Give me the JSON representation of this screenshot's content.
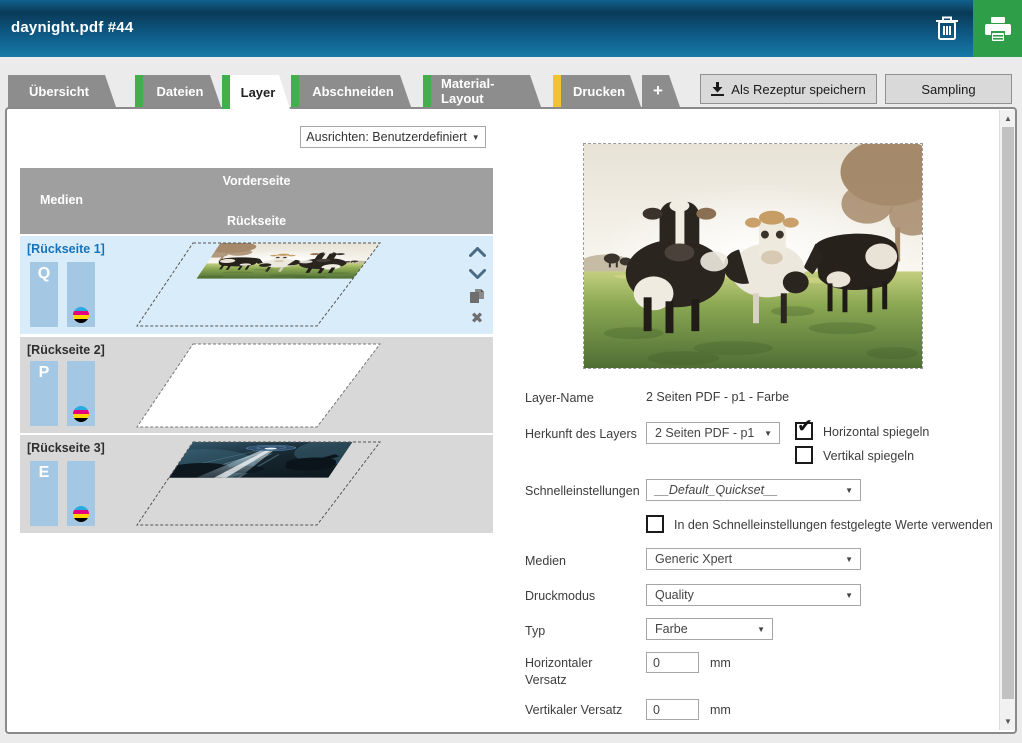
{
  "title_bar": {
    "title": "daynight.pdf #44",
    "trash_icon": "trash",
    "print_icon": "printer"
  },
  "tabs": [
    {
      "label": "Übersicht",
      "accent": null,
      "active": false
    },
    {
      "label": "Dateien",
      "accent": "#43af4c",
      "active": false
    },
    {
      "label": "Layer",
      "accent": "#43af4c",
      "active": true
    },
    {
      "label": "Abschneiden",
      "accent": "#43af4c",
      "active": false
    },
    {
      "label": "Material-Layout",
      "accent": "#43af4c",
      "active": false
    },
    {
      "label": "Drucken",
      "accent": "#f2c331",
      "active": false
    },
    {
      "label": "+",
      "accent": null,
      "active": false
    }
  ],
  "actions": {
    "save_recipe_label": "Als Rezeptur speichern",
    "sampling_label": "Sampling"
  },
  "align_dropdown": {
    "value": "Ausrichten: Benutzerdefiniert"
  },
  "media_table": {
    "col_medien": "Medien",
    "col_front": "Vorderseite",
    "col_back": "Rückseite",
    "rows": [
      {
        "label": "[Rückseite 1]",
        "badge": "Q",
        "selected": true,
        "thumb": "cows-day-mirrored"
      },
      {
        "label": "[Rückseite 2]",
        "badge": "P",
        "selected": false,
        "thumb": "blank-sheet"
      },
      {
        "label": "[Rückseite 3]",
        "badge": "E",
        "selected": false,
        "thumb": "cows-night"
      }
    ]
  },
  "form": {
    "layer_name_label": "Layer-Name",
    "layer_name_value": "2 Seiten PDF - p1 - Farbe",
    "origin_label": "Herkunft des Layers",
    "origin_value": "2 Seiten PDF - p1",
    "mirror_h_label": "Horizontal spiegeln",
    "mirror_h_checked": true,
    "mirror_v_label": "Vertikal spiegeln",
    "mirror_v_checked": false,
    "quickset_label": "Schnelleinstellungen",
    "quickset_value": "__Default_Quickset__",
    "use_quickset_label": "In den Schnelleinstellungen festgelegte Werte verwenden",
    "use_quickset_checked": false,
    "media_label": "Medien",
    "media_value": "Generic Xpert",
    "printmode_label": "Druckmodus",
    "printmode_value": "Quality",
    "type_label": "Typ",
    "type_value": "Farbe",
    "offset_h_label": "Horizontaler Versatz",
    "offset_h_value": "0",
    "offset_h_unit": "mm",
    "offset_v_label": "Vertikaler Versatz",
    "offset_v_value": "0",
    "offset_v_unit": "mm"
  },
  "icons": {
    "dropdown_arrow": "▼",
    "check": "✔",
    "uncheck": "",
    "delete_x": "✖",
    "scroll_up": "▲",
    "scroll_down": "▼"
  },
  "colors": {
    "header_gradient_top": "#11618e",
    "header_gradient_dark": "#0a3a58",
    "header_gradient_bottom": "#1779a8",
    "print_button_green": "#2f9e49",
    "tab_gray": "#8d8d8d",
    "accent_green": "#43af4c",
    "accent_yellow": "#f2c331",
    "table_header_gray": "#9f9f9f",
    "row_selected_blue": "#d9ecf9",
    "row_gray": "#d8d8d8",
    "badge_blue": "#a4c8e4",
    "selected_label_blue": "#1773b9"
  }
}
